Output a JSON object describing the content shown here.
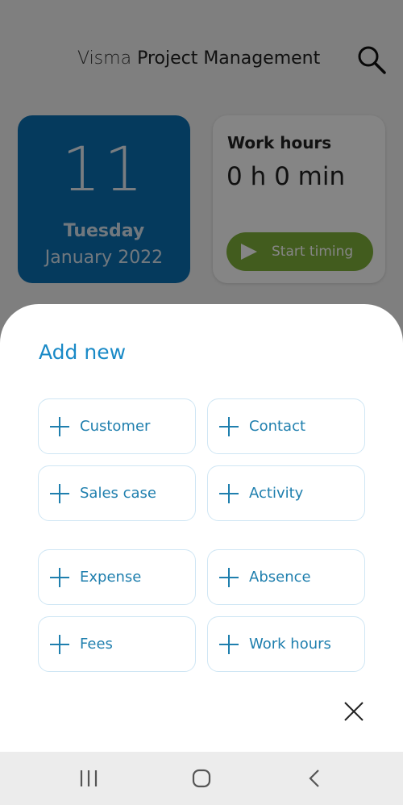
{
  "header": {
    "brand_light": "Visma",
    "brand_bold": "Project Management"
  },
  "date_card": {
    "day": "11",
    "weekday": "Tuesday",
    "month_year": "January 2022"
  },
  "hours_card": {
    "title": "Work hours",
    "value": "0 h 0 min",
    "start_label": "Start timing"
  },
  "sheet": {
    "title": "Add new",
    "actions": [
      {
        "label": "Customer"
      },
      {
        "label": "Contact"
      },
      {
        "label": "Sales case"
      },
      {
        "label": "Activity"
      },
      {
        "label": "Expense"
      },
      {
        "label": "Absence"
      },
      {
        "label": "Fees"
      },
      {
        "label": "Work hours"
      }
    ]
  },
  "colors": {
    "accent": "#1a8ac7",
    "date_card": "#0a6fb3",
    "start_button": "#7fb13b"
  },
  "icons": [
    "search-icon",
    "play-icon",
    "plus-icon",
    "close-icon",
    "nav-recents-icon",
    "nav-home-icon",
    "nav-back-icon"
  ]
}
